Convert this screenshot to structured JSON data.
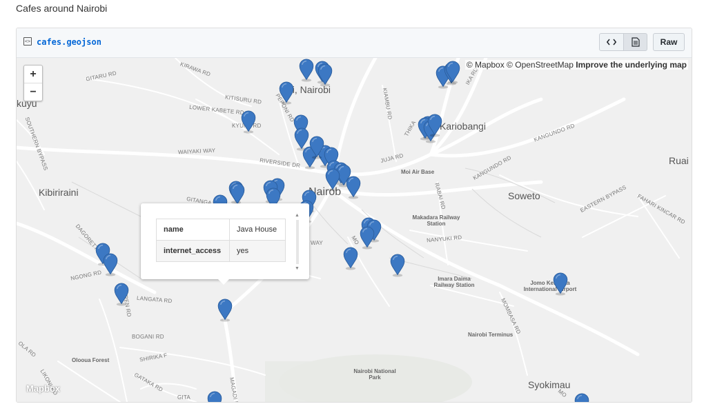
{
  "page": {
    "title": "Cafes around Nairobi"
  },
  "file": {
    "name": "cafes.geojson",
    "code_icon": "<>",
    "raw_label": "Raw"
  },
  "map": {
    "attribution": "© Mapbox © OpenStreetMap",
    "improve_link": "Improve the underlying map",
    "zoom_in": "+",
    "zoom_out": "−",
    "logo": "Mapbox",
    "marker_color": "#3c78c3",
    "places": {
      "parklands": "iri, Nairobi",
      "kariobangi": "Kariobangi",
      "nairobi": "Nairob",
      "kibiriraini": "Kibiriraini",
      "soweto": "Soweto",
      "ruai": "Ruai",
      "kuyu": "kuyu",
      "syokimau": "Syokimau"
    },
    "roads": {
      "kirawa": "Kirawa Rd",
      "gitaru": "Gitaru Rd",
      "kitisuru": "Kitisuru Rd",
      "peponi": "Peponi Rd",
      "lower_kabete": "Lower Kabete Rd",
      "kyuna": "Kyuna Rd",
      "waiyaki": "Waiyaki Way",
      "riverside": "Riverside Dr",
      "gitanga": "Gitanga",
      "juja": "Juja Rd",
      "kiambu": "Kiambu Rd",
      "thika": "Thika",
      "kangundo1": "Kangundo Rd",
      "kangundo2": "Kangundo Rd",
      "rabai": "Rabai Rd",
      "likoni": "Likoni Rd",
      "nanyuki": "Nanyuki Rd",
      "eastern_bypass": "Eastern Bypass",
      "fahari": "Fahari Kincar Rd",
      "dagoretti": "Dagoretti Rd",
      "ngong": "Ngong Rd",
      "langata": "Langata Rd",
      "karen": "Karen Rd",
      "bogani": "Bogani Rd",
      "mombasa": "Mombasa Rd",
      "magadi": "Magadi Rd",
      "gataka": "Gataka Rd",
      "shirika": "Shirika F",
      "mogotio": "Mo",
      "southern_bypass": "Southern Bypass",
      "gita": "Gita",
      "ola": "ola Rd",
      "ika": "ika Rd",
      "mbagathi": "Mo"
    },
    "pois": {
      "moi_air_base": "Moi Air Base",
      "makadara": "Makadara Railway Station",
      "imara_daima": "Imara Daima Railway Station",
      "jkia": "Jomo Kenyatta International Airport",
      "nairobi_terminus": "Nairobi Terminus",
      "olooua": "Olooua Forest",
      "national_park": "Nairobi National Park"
    },
    "partial_labels": {
      "way": "Way"
    }
  },
  "popup": {
    "rows": [
      {
        "key": "name",
        "value": "Java House"
      },
      {
        "key": "internet_access",
        "value": "yes"
      }
    ]
  }
}
